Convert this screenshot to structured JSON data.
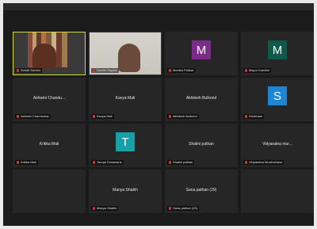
{
  "participants": [
    {
      "name": "Sonali Suresh",
      "display": "",
      "avatar_letter": "",
      "avatar_color": "",
      "type": "video",
      "active": true
    },
    {
      "name": "Sachin Sapkal",
      "display": "",
      "avatar_letter": "",
      "avatar_color": "",
      "type": "video",
      "active": false
    },
    {
      "name": "Monika Pritikar",
      "display": "",
      "avatar_letter": "M",
      "avatar_color": "#7d2b8a",
      "type": "avatar",
      "active": false
    },
    {
      "name": "Mayur Kamble",
      "display": "",
      "avatar_letter": "M",
      "avatar_color": "#0d5a4d",
      "type": "avatar",
      "active": false
    },
    {
      "name": "Ashwini Chandurkar",
      "display": "Ashwini Chandu...",
      "avatar_letter": "",
      "avatar_color": "",
      "type": "name",
      "active": false
    },
    {
      "name": "Kavya Mali",
      "display": "Kavya Mali",
      "avatar_letter": "",
      "avatar_color": "",
      "type": "name",
      "active": false
    },
    {
      "name": "Akhilesh Bulkond",
      "display": "Akhilesh Bulkond",
      "avatar_letter": "",
      "avatar_color": "",
      "type": "name",
      "active": false
    },
    {
      "name": "Shubham",
      "display": "",
      "avatar_letter": "S",
      "avatar_color": "#1f86d6",
      "type": "avatar",
      "active": false
    },
    {
      "name": "Kritika Mali",
      "display": "Kritika Mali",
      "avatar_letter": "",
      "avatar_color": "",
      "type": "name",
      "active": false
    },
    {
      "name": "Tanuja Sonawane",
      "display": "",
      "avatar_letter": "T",
      "avatar_color": "#17a0a8",
      "type": "avatar",
      "active": false
    },
    {
      "name": "Shalini pathan",
      "display": "Shalini pathan",
      "avatar_letter": "",
      "avatar_color": "",
      "type": "name",
      "active": false
    },
    {
      "name": "Vidyaratna Murdeshwar",
      "display": "Vidyaratna mur...",
      "avatar_letter": "",
      "avatar_color": "",
      "type": "name",
      "active": false
    },
    {
      "name": "",
      "display": "",
      "avatar_letter": "",
      "avatar_color": "",
      "type": "empty",
      "active": false
    },
    {
      "name": "Manya Shaikh",
      "display": "Manya Shaikh",
      "avatar_letter": "",
      "avatar_color": "",
      "type": "name",
      "active": false
    },
    {
      "name": "Sana pathan (29)",
      "display": "Sana pathan (29)",
      "avatar_letter": "",
      "avatar_color": "",
      "type": "name",
      "active": false
    },
    {
      "name": "",
      "display": "",
      "avatar_letter": "",
      "avatar_color": "",
      "type": "empty",
      "active": false
    }
  ]
}
